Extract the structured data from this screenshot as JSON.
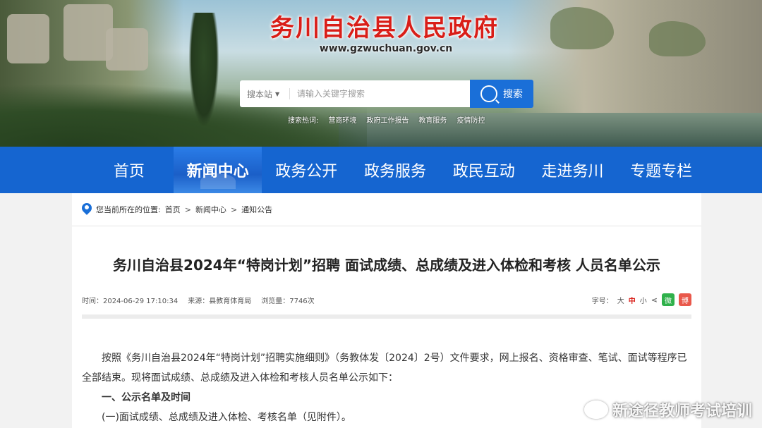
{
  "header": {
    "site_title": "务川自治县人民政府",
    "site_url": "www.gzwuchuan.gov.cn",
    "search": {
      "scope": "搜本站",
      "placeholder": "请输入关键字搜索",
      "button_label": "搜索"
    },
    "hot_words_label": "搜索热词:",
    "hot_words": [
      "营商环境",
      "政府工作报告",
      "教育服务",
      "疫情防控"
    ]
  },
  "nav": {
    "items": [
      {
        "label": "首页",
        "active": false
      },
      {
        "label": "新闻中心",
        "active": true
      },
      {
        "label": "政务公开",
        "active": false
      },
      {
        "label": "政务服务",
        "active": false
      },
      {
        "label": "政民互动",
        "active": false
      },
      {
        "label": "走进务川",
        "active": false
      },
      {
        "label": "专题专栏",
        "active": false
      }
    ]
  },
  "breadcrumb": {
    "prefix": "您当前所在的位置:",
    "items": [
      "首页",
      "新闻中心",
      "通知公告"
    ],
    "separator": ">"
  },
  "article": {
    "title": "务川自治县2024年“特岗计划”招聘 面试成绩、总成绩及进入体检和考核 人员名单公示",
    "meta": {
      "time": "时间：2024-06-29 17:10:34",
      "source": "来源：县教育体育局",
      "views": "浏览量：7746次"
    },
    "tools": {
      "font_label": "字号：",
      "large": "大",
      "medium": "中",
      "small": "小",
      "wechat": "微",
      "weibo": "博"
    },
    "body": {
      "paragraph": "按照《务川自治县2024年“特岗计划”招聘实施细则》（务教体发〔2024〕2号）文件要求，网上报名、资格审查、笔试、面试等程序已全部结束。现将面试成绩、总成绩及进入体检和考核人员名单公示如下：",
      "heading": "一、公示名单及时间",
      "subitem": "(一)面试成绩、总成绩及进入体检、考核名单（见附件）。"
    }
  },
  "watermark": {
    "text": "新途径教师考试培训"
  },
  "colors": {
    "nav_bg": "#1565d0",
    "search_button": "#1a6fd8",
    "title_red": "#d91e18"
  }
}
